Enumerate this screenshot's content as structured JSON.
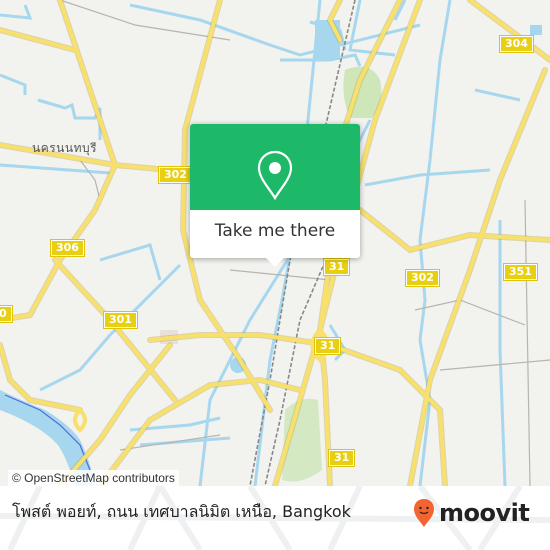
{
  "map": {
    "place_labels": [
      {
        "text": "นครนนทบุรี"
      }
    ],
    "road_badges": [
      {
        "label": "304"
      },
      {
        "label": "302"
      },
      {
        "label": "306"
      },
      {
        "label": "301"
      },
      {
        "label": "31"
      },
      {
        "label": "302"
      },
      {
        "label": "351"
      },
      {
        "label": "31"
      },
      {
        "label": "31"
      },
      {
        "label": "0"
      }
    ],
    "attribution": "© OpenStreetMap contributors"
  },
  "popup": {
    "icon": "location-pin-icon",
    "button_label": "Take me there"
  },
  "footer": {
    "address": "โพสต์ พอยท์, ถนน เทศบาลนิมิต เหนือ, Bangkok",
    "logo_text": "moovit",
    "colors": {
      "brand_orange": "#f26430",
      "popup_green": "#1db868"
    }
  }
}
